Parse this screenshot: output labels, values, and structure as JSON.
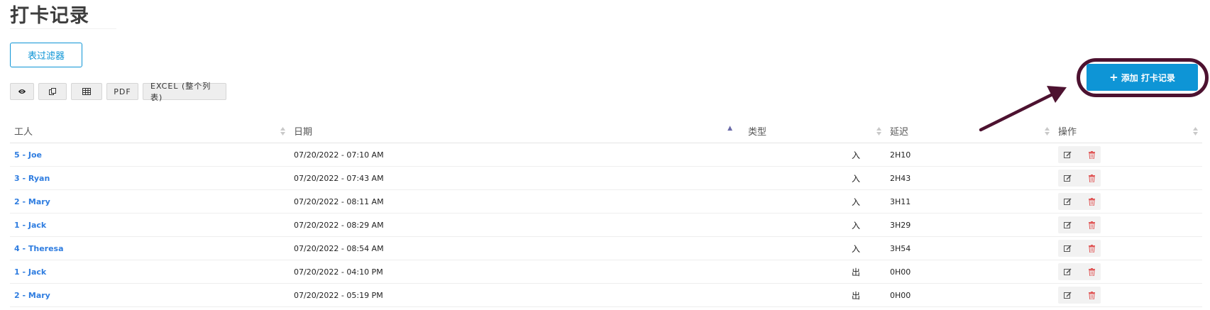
{
  "page": {
    "title": "打卡记录"
  },
  "filter_button": {
    "label": "表过滤器"
  },
  "toolbar": {
    "items": [
      {
        "icon": "eye-icon",
        "label": ""
      },
      {
        "icon": "copy-icon",
        "label": ""
      },
      {
        "icon": "table-icon",
        "label": ""
      },
      {
        "icon": "",
        "label": "PDF"
      },
      {
        "icon": "",
        "label": "EXCEL (整个列表)"
      }
    ]
  },
  "add_button": {
    "label": "添加 打卡记录",
    "icon": "plus-icon"
  },
  "table": {
    "columns": [
      "工人",
      "日期",
      "类型",
      "延迟",
      "操作"
    ],
    "sorted_column": "日期",
    "rows": [
      {
        "worker": "5 - Joe",
        "date": "07/20/2022 - 07:10 AM",
        "type": "入",
        "delay": "2H10"
      },
      {
        "worker": "3 - Ryan",
        "date": "07/20/2022 - 07:43 AM",
        "type": "入",
        "delay": "2H43"
      },
      {
        "worker": "2 - Mary",
        "date": "07/20/2022 - 08:11 AM",
        "type": "入",
        "delay": "3H11"
      },
      {
        "worker": "1 - Jack",
        "date": "07/20/2022 - 08:29 AM",
        "type": "入",
        "delay": "3H29"
      },
      {
        "worker": "4 - Theresa",
        "date": "07/20/2022 - 08:54 AM",
        "type": "入",
        "delay": "3H54"
      },
      {
        "worker": "1 - Jack",
        "date": "07/20/2022 - 04:10 PM",
        "type": "出",
        "delay": "0H00"
      },
      {
        "worker": "2 - Mary",
        "date": "07/20/2022 - 05:19 PM",
        "type": "出",
        "delay": "0H00"
      }
    ]
  },
  "colors": {
    "accent": "#0e95d6",
    "link": "#2f7de0",
    "annotation": "#4d1230",
    "delete": "#e05a5a"
  }
}
